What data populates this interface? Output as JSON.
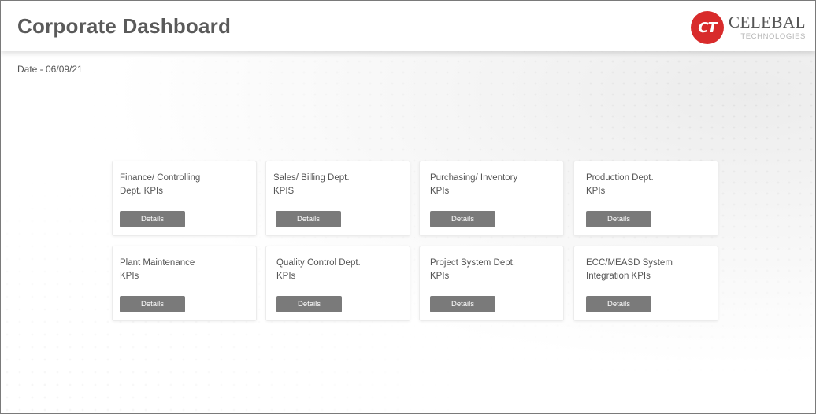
{
  "header": {
    "title": "Corporate Dashboard",
    "logo": {
      "badge_text": "CT",
      "name": "CELEBAL",
      "sub": "TECHNOLOGIES",
      "badge_color": "#d82b2b"
    }
  },
  "date_text": "Date - 06/09/21",
  "cards": [
    {
      "title_line1": "Finance/ Controlling",
      "title_line2": "Dept. KPIs",
      "button_label": "Details"
    },
    {
      "title_line1": "Sales/ Billing Dept.",
      "title_line2": "KPIS",
      "button_label": "Details"
    },
    {
      "title_line1": "Purchasing/ Inventory",
      "title_line2": "KPIs",
      "button_label": "Details"
    },
    {
      "title_line1": "Production Dept.",
      "title_line2": "KPIs",
      "button_label": "Details"
    },
    {
      "title_line1": "Plant Maintenance",
      "title_line2": "KPIs",
      "button_label": "Details"
    },
    {
      "title_line1": "Quality Control Dept.",
      "title_line2": "KPIs",
      "button_label": "Details"
    },
    {
      "title_line1": "Project System Dept.",
      "title_line2": "KPIs",
      "button_label": "Details"
    },
    {
      "title_line1": "ECC/MEASD System",
      "title_line2": "Integration KPIs",
      "button_label": "Details"
    }
  ],
  "colors": {
    "button_bg": "#7a7a7a",
    "title_text": "#5a5a5a"
  }
}
